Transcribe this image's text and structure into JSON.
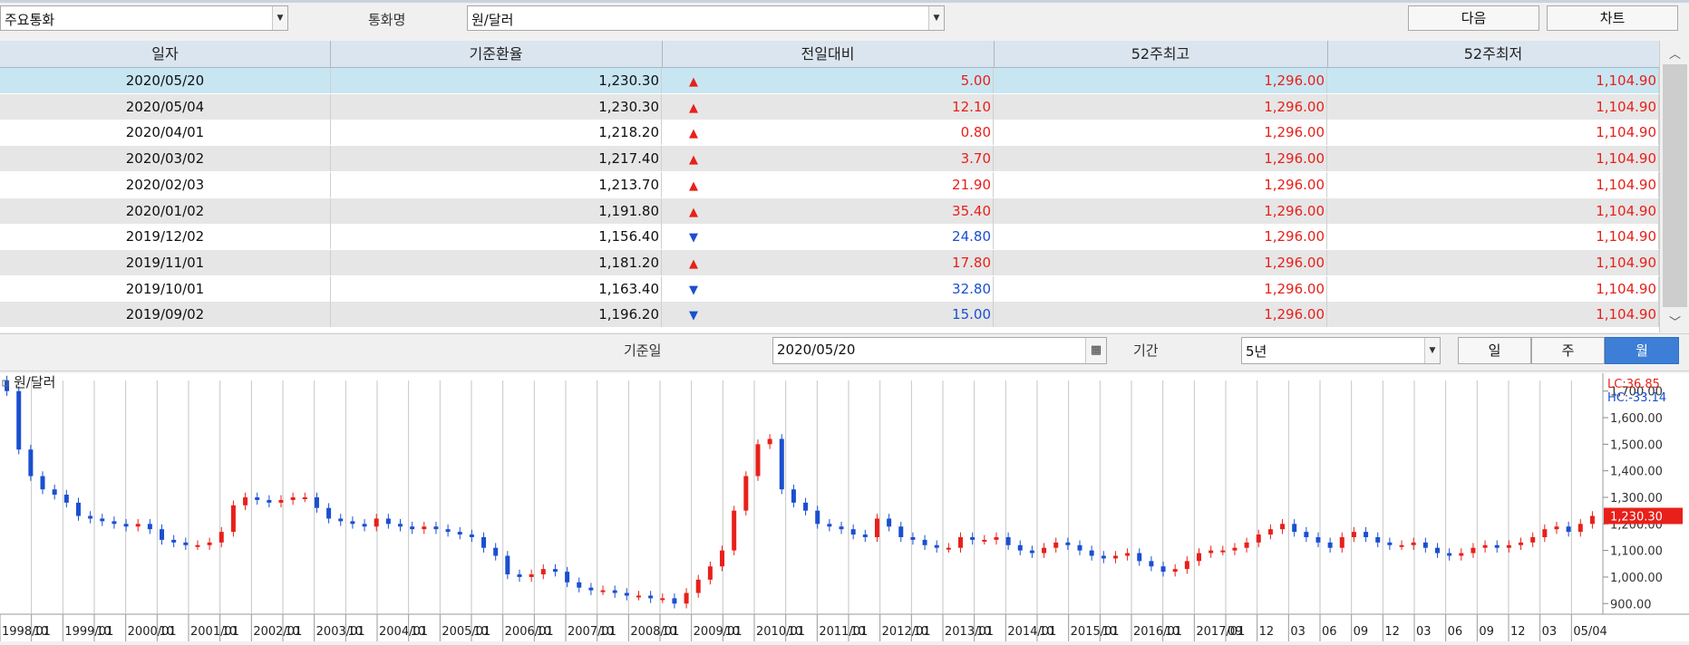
{
  "toolbar": {
    "category_value": "주요통화",
    "currency_label": "통화명",
    "currency_value": "원/달러",
    "next_button": "다음",
    "chart_button": "차트"
  },
  "table": {
    "headers": [
      "일자",
      "기준환율",
      "전일대비",
      "52주최고",
      "52주최저"
    ],
    "rows": [
      {
        "date": "2020/05/20",
        "rate": "1,230.30",
        "dir": "up",
        "change": "5.00",
        "high": "1,296.00",
        "low": "1,104.90"
      },
      {
        "date": "2020/05/04",
        "rate": "1,230.30",
        "dir": "up",
        "change": "12.10",
        "high": "1,296.00",
        "low": "1,104.90"
      },
      {
        "date": "2020/04/01",
        "rate": "1,218.20",
        "dir": "up",
        "change": "0.80",
        "high": "1,296.00",
        "low": "1,104.90"
      },
      {
        "date": "2020/03/02",
        "rate": "1,217.40",
        "dir": "up",
        "change": "3.70",
        "high": "1,296.00",
        "low": "1,104.90"
      },
      {
        "date": "2020/02/03",
        "rate": "1,213.70",
        "dir": "up",
        "change": "21.90",
        "high": "1,296.00",
        "low": "1,104.90"
      },
      {
        "date": "2020/01/02",
        "rate": "1,191.80",
        "dir": "up",
        "change": "35.40",
        "high": "1,296.00",
        "low": "1,104.90"
      },
      {
        "date": "2019/12/02",
        "rate": "1,156.40",
        "dir": "down",
        "change": "24.80",
        "high": "1,296.00",
        "low": "1,104.90"
      },
      {
        "date": "2019/11/01",
        "rate": "1,181.20",
        "dir": "up",
        "change": "17.80",
        "high": "1,296.00",
        "low": "1,104.90"
      },
      {
        "date": "2019/10/01",
        "rate": "1,163.40",
        "dir": "down",
        "change": "32.80",
        "high": "1,296.00",
        "low": "1,104.90"
      },
      {
        "date": "2019/09/02",
        "rate": "1,196.20",
        "dir": "down",
        "change": "15.00",
        "high": "1,296.00",
        "low": "1,104.90"
      }
    ]
  },
  "filter": {
    "base_date_label": "기준일",
    "base_date_value": "2020/05/20",
    "period_label": "기간",
    "period_value": "5년",
    "seg_day": "일",
    "seg_week": "주",
    "seg_month": "월",
    "selected": "월"
  },
  "chart_data": {
    "type": "candlestick",
    "legend": "원/달러",
    "lc_label": "LC:36.85",
    "hc_label": "HC:-33.14",
    "current_label": "1,230.30",
    "y_ticks": [
      "1,700.00",
      "1,600.00",
      "1,500.00",
      "1,400.00",
      "1,300.00",
      "1,200.00",
      "1,100.00",
      "1,000.00",
      "900.00"
    ],
    "ylim": [
      860,
      1740
    ],
    "x_labels": [
      "1998/01",
      "10",
      "1999/01",
      "10",
      "2000/01",
      "10",
      "2001/01",
      "10",
      "2002/01",
      "10",
      "2003/01",
      "10",
      "2004/01",
      "10",
      "2005/01",
      "10",
      "2006/01",
      "10",
      "2007/01",
      "10",
      "2008/01",
      "10",
      "2009/01",
      "10",
      "2010/01",
      "10",
      "2011/01",
      "10",
      "2012/01",
      "10",
      "2013/01",
      "10",
      "2014/01",
      "10",
      "2015/01",
      "10",
      "2016/01",
      "10",
      "2017/01",
      "09",
      "12",
      "03",
      "06",
      "09",
      "12",
      "03",
      "06",
      "09",
      "12",
      "03",
      "05/04"
    ],
    "series": [
      {
        "values": [
          1700,
          1480,
          1380,
          1330,
          1310,
          1280,
          1230,
          1220,
          1210,
          1200,
          1190,
          1200,
          1180,
          1140,
          1130,
          1120,
          1120,
          1130,
          1170,
          1270,
          1300,
          1290,
          1280,
          1290,
          1300,
          1300,
          1260,
          1220,
          1210,
          1200,
          1190,
          1220,
          1200,
          1190,
          1180,
          1190,
          1180,
          1170,
          1160,
          1150,
          1110,
          1080,
          1010,
          1000,
          1010,
          1030,
          1020,
          980,
          960,
          950,
          950,
          940,
          930,
          930,
          920,
          920,
          900,
          940,
          990,
          1040,
          1100,
          1250,
          1380,
          1500,
          1520,
          1330,
          1280,
          1250,
          1200,
          1190,
          1180,
          1160,
          1150,
          1220,
          1190,
          1150,
          1140,
          1120,
          1110,
          1110,
          1150,
          1140,
          1140,
          1150,
          1120,
          1100,
          1090,
          1110,
          1130,
          1120,
          1100,
          1080,
          1070,
          1080,
          1090,
          1060,
          1040,
          1020,
          1030,
          1060,
          1090,
          1100,
          1100,
          1110,
          1130,
          1160,
          1180,
          1200,
          1170,
          1150,
          1130,
          1110,
          1150,
          1170,
          1150,
          1130,
          1120,
          1120,
          1130,
          1110,
          1090,
          1080,
          1090,
          1110,
          1120,
          1110,
          1120,
          1130,
          1150,
          1180,
          1190,
          1170,
          1200,
          1230
        ]
      }
    ]
  }
}
